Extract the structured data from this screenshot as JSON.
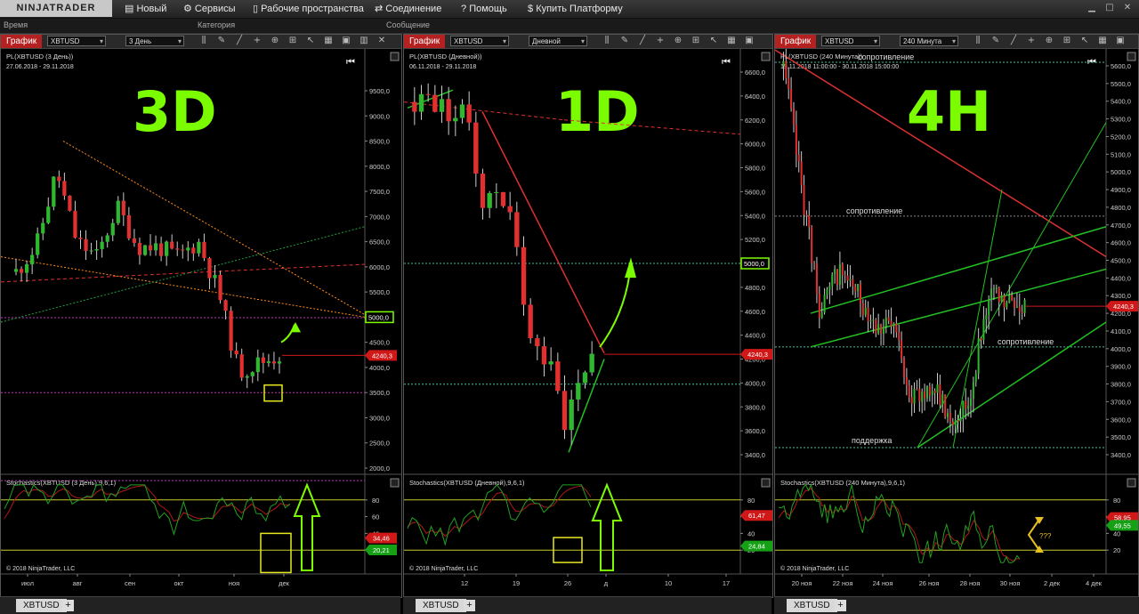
{
  "app": {
    "logo": "NINJATRADER",
    "menu": [
      {
        "icon": "panel-icon",
        "glyph": "▤",
        "label": "Новый"
      },
      {
        "icon": "tools-icon",
        "glyph": "⚙",
        "label": "Сервисы"
      },
      {
        "icon": "workspace-icon",
        "glyph": "▯",
        "label": "Рабочие пространства"
      },
      {
        "icon": "connection-icon",
        "glyph": "⇄",
        "label": "Соединение"
      },
      {
        "icon": "help-icon",
        "glyph": "?",
        "label": "Помощь"
      },
      {
        "icon": "dollar-icon",
        "glyph": "$",
        "label": "Купить Платформу"
      }
    ],
    "log_headers": [
      "Время",
      "Категория",
      "Сообщение"
    ],
    "colors": {
      "up": "#2fb82f",
      "down": "#e03030",
      "accent": "#7CFC00",
      "red_tag": "#d01818"
    }
  },
  "panels": [
    {
      "tab_label": "График",
      "instrument": "XBTUSD",
      "period": "3 День",
      "title": "PL(XBTUSD (3 День))",
      "date_range": "27.06.2018 - 29.11.2018",
      "big_label": "3D",
      "y_ticks": [
        "9500,0",
        "9000,0",
        "8500,0",
        "8000,0",
        "7500,0",
        "7000,0",
        "6500,0",
        "6000,0",
        "5500,0",
        "5000,0",
        "4500,0",
        "4000,0",
        "3500,0",
        "3000,0",
        "2500,0",
        "2000,0"
      ],
      "price_boxed": "5000,0",
      "price_tag": "4240,3",
      "stoch_title": "Stochastics(XBTUSD (3 День),9,6,1)",
      "stoch_ticks": [
        "80",
        "60",
        "40",
        "20"
      ],
      "stoch_d": "34,46",
      "stoch_k": "20,21",
      "copyright": "© 2018 NinjaTrader, LLC",
      "x_ticks": [
        "июл",
        "авг",
        "сен",
        "окт",
        "ноя",
        "дек"
      ],
      "tab": "XBTUSD"
    },
    {
      "tab_label": "График",
      "instrument": "XBTUSD",
      "period": "Дневной",
      "title": "PL(XBTUSD (Дневной))",
      "date_range": "06.11.2018 - 29.11.2018",
      "big_label": "1D",
      "y_ticks": [
        "6600,0",
        "6400,0",
        "6200,0",
        "6000,0",
        "5800,0",
        "5600,0",
        "5400,0",
        "5200,0",
        "5000,0",
        "4800,0",
        "4600,0",
        "4400,0",
        "4200,0",
        "4000,0",
        "3800,0",
        "3600,0",
        "3400,0"
      ],
      "price_boxed": "5000,0",
      "price_tag": "4240,3",
      "stoch_title": "Stochastics(XBTUSD (Дневной),9,6,1)",
      "stoch_ticks": [
        "80",
        "60",
        "40",
        "20"
      ],
      "stoch_d": "61,47",
      "stoch_k": "24,84",
      "copyright": "© 2018 NinjaTrader, LLC",
      "x_ticks": [
        "12",
        "19",
        "26",
        "д",
        "10",
        "17"
      ],
      "tab": "XBTUSD"
    },
    {
      "tab_label": "График",
      "instrument": "XBTUSD",
      "period": "240 Минута",
      "title": "PL(XBTUSD (240 Минута))",
      "date_range": "19.11.2018 11:00:00 - 30.11.2018 15:00:00",
      "big_label": "4H",
      "y_ticks": [
        "5600,0",
        "5500,0",
        "5400,0",
        "5300,0",
        "5200,0",
        "5100,0",
        "5000,0",
        "4900,0",
        "4800,0",
        "4700,0",
        "4600,0",
        "4500,0",
        "4400,0",
        "4300,0",
        "4200,0",
        "4100,0",
        "4000,0",
        "3900,0",
        "3800,0",
        "3700,0",
        "3600,0",
        "3500,0",
        "3400,0"
      ],
      "price_tag": "4240,3",
      "annotations": [
        "сопротивление",
        "сопротивление",
        "сопротивление",
        "поддержка"
      ],
      "stoch_title": "Stochastics(XBTUSD (240 Минута),9,6,1)",
      "stoch_ticks": [
        "80",
        "60",
        "40",
        "20"
      ],
      "stoch_d": "58,95",
      "stoch_k": "49,55",
      "question": "???",
      "copyright": "© 2018 NinjaTrader, LLC",
      "x_ticks": [
        "20 ноя",
        "22 ноя",
        "24 ноя",
        "26 ноя",
        "28 ноя",
        "30 ноя",
        "2 дек",
        "4 дек"
      ],
      "tab": "XBTUSD"
    }
  ]
}
